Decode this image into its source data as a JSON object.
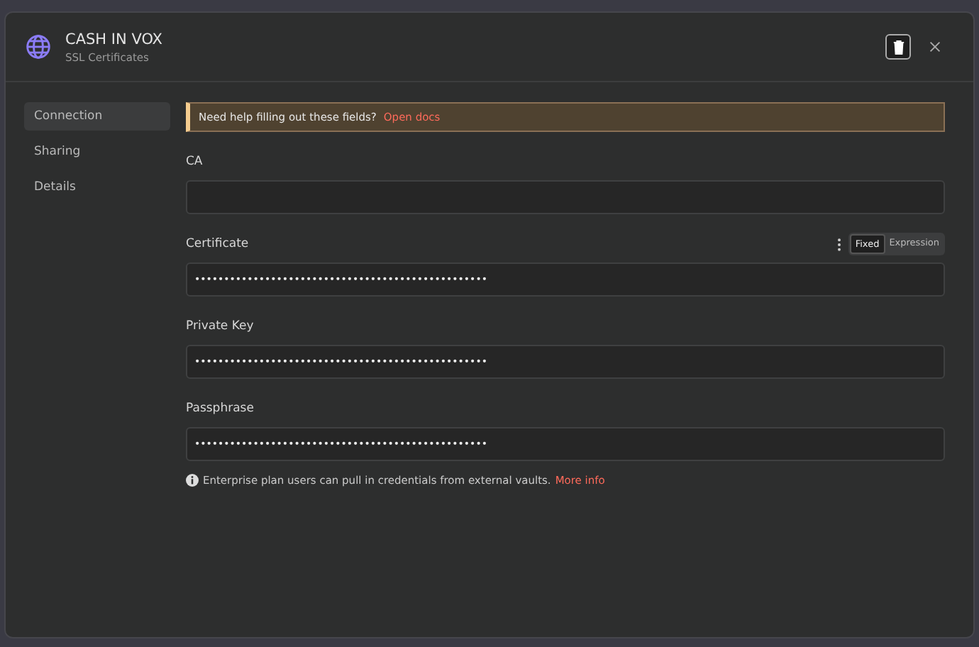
{
  "window": {
    "title": "CASH IN VOX",
    "subtitle": "SSL Certificates"
  },
  "sidebar": {
    "items": [
      {
        "label": "Connection",
        "selected": true
      },
      {
        "label": "Sharing",
        "selected": false
      },
      {
        "label": "Details",
        "selected": false
      }
    ]
  },
  "notice": {
    "text": "Need help filling out these fields?",
    "link": "Open docs"
  },
  "fields": [
    {
      "label": "CA"
    },
    {
      "label": "Certificate",
      "value": "••••••••••••••••••••••••••••••••••••••••••••••••••",
      "mode_toggle": [
        {
          "label": "Fixed",
          "selected": true
        },
        {
          "label": "Expression",
          "selected": false
        }
      ]
    },
    {
      "label": "Private Key",
      "value": "••••••••••••••••••••••••••••••••••••••••••••••••••"
    },
    {
      "label": "Passphrase",
      "value": "••••••••••••••••••••••••••••••••••••••••••••••••••"
    }
  ],
  "info": {
    "text": "Enterprise plan users can pull in credentials from external vaults.",
    "link": "More info"
  }
}
